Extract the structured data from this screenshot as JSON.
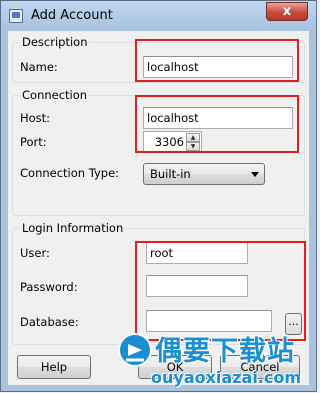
{
  "window": {
    "title": "Add Account",
    "close_glyph": "x"
  },
  "description": {
    "group_title": "Description",
    "name_label": "Name:",
    "name_value": "localhost"
  },
  "connection": {
    "group_title": "Connection",
    "host_label": "Host:",
    "host_value": "localhost",
    "port_label": "Port:",
    "port_value": "3306",
    "type_label": "Connection Type:",
    "type_value": "Built-in"
  },
  "login": {
    "group_title": "Login Information",
    "user_label": "User:",
    "user_value": "root",
    "password_label": "Password:",
    "password_value": "",
    "database_label": "Database:",
    "database_value": "",
    "browse_label": "..."
  },
  "buttons": {
    "help": "Help",
    "ok": "OK",
    "cancel": "Cancel"
  },
  "watermark": {
    "brand_text": "偶要下载站",
    "url": "ouyaoxiazai.com"
  },
  "colors": {
    "highlight": "#e11d1d",
    "watermark": "#1a8ed0"
  }
}
